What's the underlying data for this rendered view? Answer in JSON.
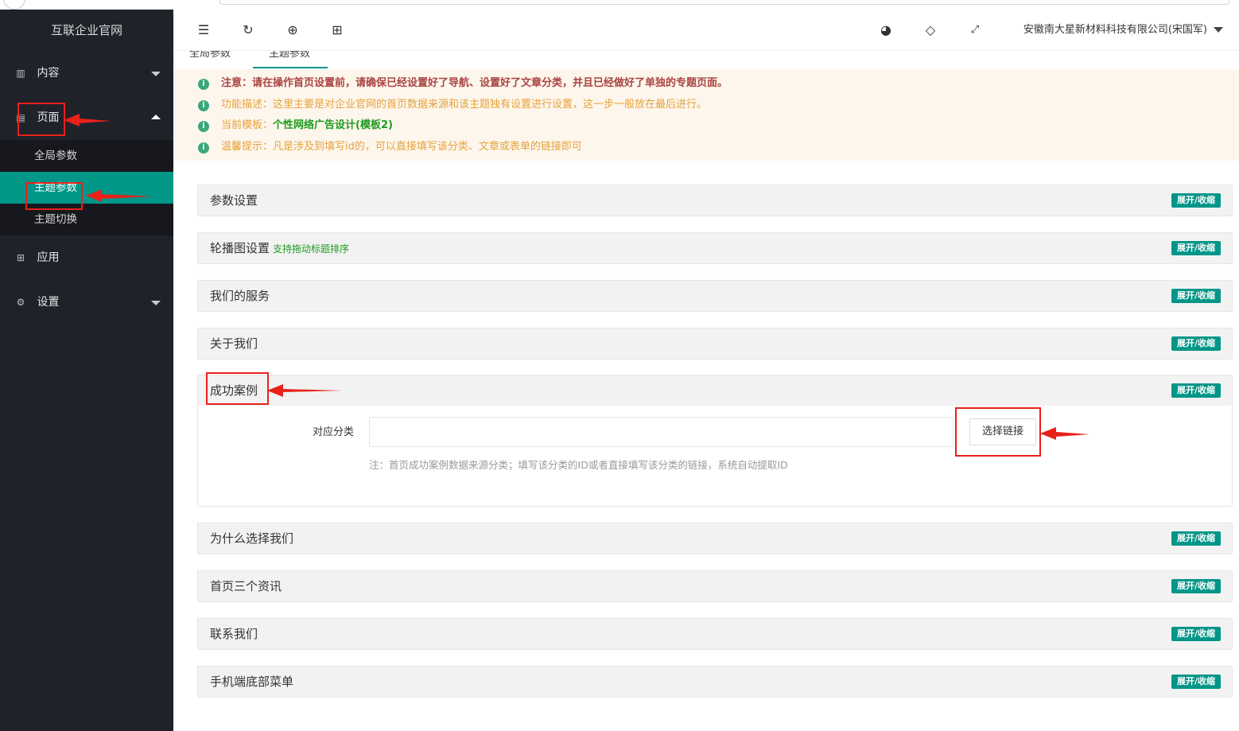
{
  "sidebar": {
    "logo": "互联企业官网",
    "items": [
      {
        "label": "内容",
        "icon": "content-icon"
      },
      {
        "label": "页面",
        "icon": "page-icon"
      },
      {
        "label": "应用",
        "icon": "apps-icon"
      },
      {
        "label": "设置",
        "icon": "settings-gear-icon"
      }
    ],
    "sub_items": [
      {
        "label": "全局参数"
      },
      {
        "label": "主题参数"
      },
      {
        "label": "主题切换"
      }
    ]
  },
  "header": {
    "user": "安徽南大星新材料科技有限公司(宋国军)",
    "icons": [
      "menu-fold-icon",
      "refresh-icon",
      "globe-icon",
      "apps-grid-icon",
      "palette-icon",
      "tag-icon",
      "fullscreen-icon"
    ]
  },
  "tabs": [
    {
      "label": "全局参数"
    },
    {
      "label": "主题参数"
    }
  ],
  "notice": {
    "line1": "注意：请在操作首页设置前，请确保已经设置好了导航、设置好了文章分类，并且已经做好了单独的专题页面。",
    "line2": "功能描述：这里主要是对企业官网的首页数据来源和该主题独有设置进行设置，这一步一般放在最后进行。",
    "line3_prefix": "当前模板：",
    "line3_value": "个性网络广告设计(模板2)",
    "line4": "温馨提示：凡是涉及到填写id的，可以直接填写该分类、文章或表单的链接即可"
  },
  "panels": {
    "p1": {
      "title": "参数设置"
    },
    "p2": {
      "title": "轮播图设置",
      "subtitle": "支持拖动标题排序"
    },
    "p3": {
      "title": "我们的服务"
    },
    "p4": {
      "title": "关于我们"
    },
    "p5": {
      "title": "成功案例",
      "field_label": "对应分类",
      "field_value": "",
      "button": "选择链接",
      "note": "注：首页成功案例数据来源分类；填写该分类的ID或者直接填写该分类的链接，系统自动提取ID"
    },
    "p6": {
      "title": "为什么选择我们"
    },
    "p7": {
      "title": "首页三个资讯"
    },
    "p8": {
      "title": "联系我们"
    },
    "p9": {
      "title": "手机端底部菜单"
    },
    "toggle_label": "展开/收缩"
  },
  "colors": {
    "sidebar_bg": "#20222a",
    "accent": "#009688",
    "annotation_red": "#e8211b",
    "notice_bg": "#fdf6ec"
  }
}
